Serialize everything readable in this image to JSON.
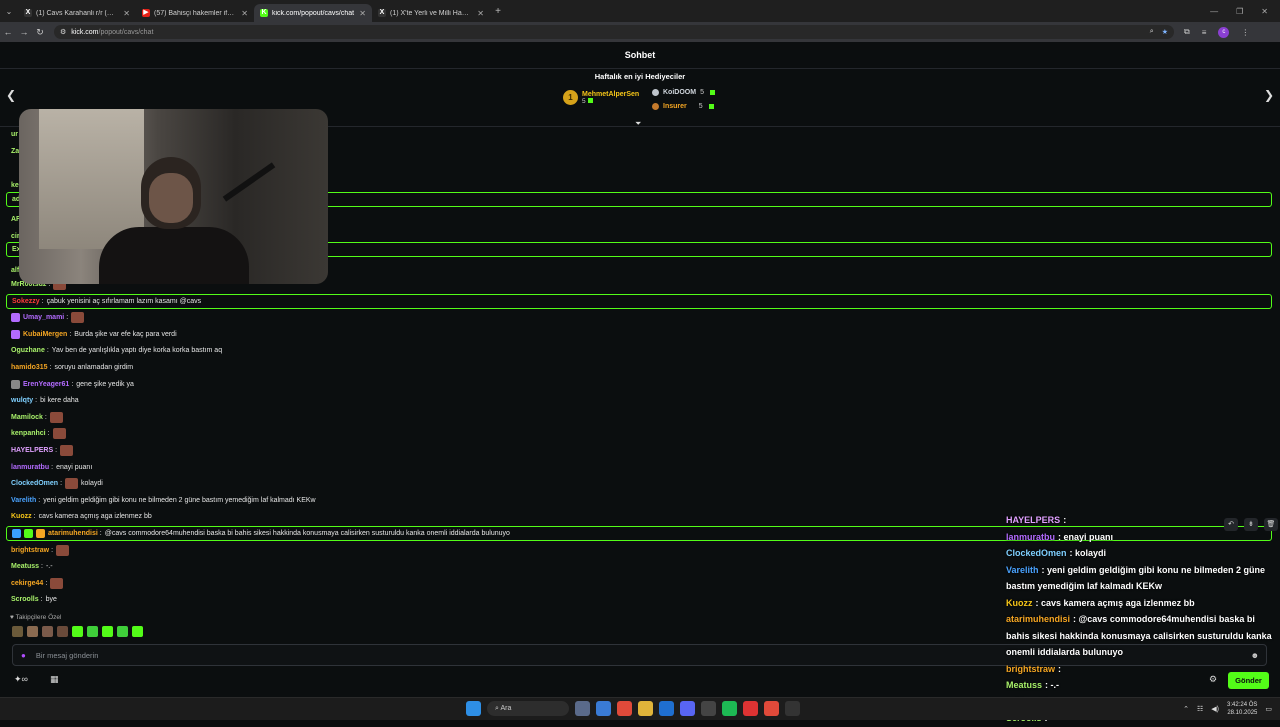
{
  "browser": {
    "tabs": [
      {
        "title": "(1) Cavs Karahanli r/r (@cerrahpasha) / X",
        "fav": "X",
        "favcolor": "#333"
      },
      {
        "title": "(57) Bahisçi hakemler ifşa oluyo...",
        "fav": "▶",
        "favcolor": "#e62117"
      },
      {
        "title": "kick.com/popout/cavs/chat",
        "fav": "K",
        "favcolor": "#53fc18"
      },
      {
        "title": "(1) X'te Yerli ve Milli Hawking...",
        "fav": "X",
        "favcolor": "#333"
      }
    ],
    "url_host": "kick.com",
    "url_path": "/popout/cavs/chat",
    "profile_initial": "c"
  },
  "chat": {
    "title": "Sohbet",
    "gifters_title": "Haftalık en iyi Hediyeciler",
    "gifters": [
      {
        "rank": "1",
        "name": "MehmetAlperSen",
        "count": "5"
      },
      {
        "name": "KoiDOOM",
        "count": "5"
      },
      {
        "name": "Insurer",
        "count": "5"
      }
    ],
    "partial_names": [
      "ur",
      "Za",
      "",
      "ke",
      "ad",
      "AF",
      "cir",
      "Ex",
      "alf"
    ],
    "messages": [
      {
        "user": "MrR00tsuz",
        "text": "",
        "color": "#a8f06a",
        "emote": true,
        "hl": false
      },
      {
        "user": "Sokezzy",
        "text": "çabuk yenisini aç sıfırlamam lazım kasamı @cavs",
        "color": "#ff3b3b",
        "emote": false,
        "hl": true
      },
      {
        "user": "Umay_mami",
        "text": "",
        "color": "#b36bff",
        "emote": true,
        "hl": false
      },
      {
        "user": "KubaiMergen",
        "text": "Burda şike var efe kaç para verdi",
        "color": "#f5a623",
        "emote": false,
        "hl": false
      },
      {
        "user": "Oguzhane",
        "text": "Yav ben de yanlışlıkla yaptı diye korka korka bastım aq",
        "color": "#a8f06a",
        "emote": false,
        "hl": false
      },
      {
        "user": "hamido315",
        "text": "soruyu anlamadan girdim",
        "color": "#f5a623",
        "emote": false,
        "hl": false
      },
      {
        "user": "ErenYeager61",
        "text": "gene şike yedik ya",
        "color": "#b36bff",
        "emote": false,
        "hl": false
      },
      {
        "user": "wulqty",
        "text": "bi kere daha",
        "color": "#7fd0ff",
        "emote": false,
        "hl": false
      },
      {
        "user": "Mamilock",
        "text": "",
        "color": "#a8f06a",
        "emote": true,
        "hl": false
      },
      {
        "user": "kenpanhci",
        "text": "",
        "color": "#a8f06a",
        "emote": true,
        "hl": false
      },
      {
        "user": "HAYELPERS",
        "text": "",
        "color": "#e0a0ff",
        "emote": true,
        "hl": false
      },
      {
        "user": "lanmuratbu",
        "text": "enayi puanı",
        "color": "#b36bff",
        "emote": false,
        "hl": false
      },
      {
        "user": "ClockedOmen",
        "text": "kolaydi",
        "color": "#7fd0ff",
        "emote": true,
        "hl": false
      },
      {
        "user": "Varelith",
        "text": "yeni geldim geldiğim gibi konu ne bilmeden 2 güne bastım yemediğim laf kalmadı KEKw",
        "color": "#4aa3ff",
        "emote": false,
        "hl": false
      },
      {
        "user": "Kuozz",
        "text": "cavs kamera açmış aga izlenmez bb",
        "color": "#f5c518",
        "emote": false,
        "hl": false
      },
      {
        "user": "atarimuhendisi",
        "text": "@cavs commodore64muhendisi baska bi bahis sikesi hakkinda konusmaya calisirken susturuldu kanka onemli iddialarda bulunuyo",
        "color": "#f5a623",
        "emote": false,
        "hl": true
      },
      {
        "user": "brightstraw",
        "text": "",
        "color": "#f5a623",
        "emote": true,
        "hl": false
      },
      {
        "user": "Meatuss",
        "text": "-.-",
        "color": "#a8f06a",
        "emote": false,
        "hl": false
      },
      {
        "user": "cekirge44",
        "text": "",
        "color": "#f5a623",
        "emote": true,
        "hl": false
      },
      {
        "user": "Scroolls",
        "text": "bye",
        "color": "#a8f06a",
        "emote": false,
        "hl": false
      }
    ],
    "followers_label": "Takipçilere Özel",
    "input_placeholder": "Bir mesaj gönderin",
    "send_label": "Gönder"
  },
  "overlay": [
    {
      "user": "HAYELPERS",
      "text": "",
      "color": "#e0a0ff"
    },
    {
      "user": "lanmuratbu",
      "text": "enayi puanı",
      "color": "#b36bff"
    },
    {
      "user": "ClockedOmen",
      "text": "kolaydi",
      "color": "#7fd0ff"
    },
    {
      "user": "Varelith",
      "text": "yeni geldim geldiğim gibi konu ne bilmeden 2 güne bastım yemediğim laf kalmadı KEKw",
      "color": "#4aa3ff"
    },
    {
      "user": "Kuozz",
      "text": "cavs kamera açmış aga izlenmez bb",
      "color": "#f5c518"
    },
    {
      "user": "atarimuhendisi",
      "text": "@cavs commodore64muhendisi baska bi bahis sikesi hakkinda konusmaya calisirken susturuldu kanka onemli iddialarda bulunuyo",
      "color": "#f5a623"
    },
    {
      "user": "brightstraw",
      "text": "",
      "color": "#f5a623"
    },
    {
      "user": "Meatuss",
      "text": "-.-",
      "color": "#a8f06a"
    },
    {
      "user": "cekirge44",
      "text": "",
      "color": "#a8f06a"
    },
    {
      "user": "Scroolls",
      "text": "",
      "color": "#a8f06a"
    }
  ],
  "taskbar": {
    "search_label": "Ara",
    "time": "3:42:24 ÖS",
    "date": "28.10.2025"
  },
  "colors": {
    "accent": "#53fc18",
    "bg": "#0b0e0f"
  }
}
